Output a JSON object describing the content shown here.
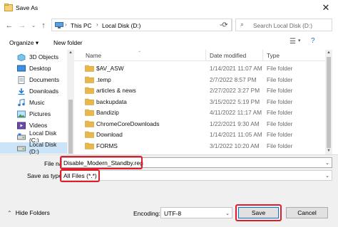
{
  "window": {
    "title": "Save As"
  },
  "address": {
    "crumbs": [
      "This PC",
      "Local Disk (D:)"
    ]
  },
  "search": {
    "placeholder": "Search Local Disk (D:)"
  },
  "toolbar": {
    "organize": "Organize ▾",
    "new_folder": "New folder"
  },
  "sidebar": {
    "items": [
      {
        "label": "3D Objects",
        "icon": "cube-icon"
      },
      {
        "label": "Desktop",
        "icon": "desktop-icon"
      },
      {
        "label": "Documents",
        "icon": "documents-icon"
      },
      {
        "label": "Downloads",
        "icon": "downloads-icon"
      },
      {
        "label": "Music",
        "icon": "music-icon"
      },
      {
        "label": "Pictures",
        "icon": "pictures-icon"
      },
      {
        "label": "Videos",
        "icon": "videos-icon"
      },
      {
        "label": "Local Disk (C:)",
        "icon": "drive-icon"
      },
      {
        "label": "Local Disk (D:)",
        "icon": "drive-icon",
        "selected": true
      }
    ]
  },
  "files": {
    "columns": {
      "name": "Name",
      "date": "Date modified",
      "type": "Type"
    },
    "rows": [
      {
        "name": "$AV_ASW",
        "date": "1/14/2021 11:07 AM",
        "type": "File folder"
      },
      {
        "name": ".temp",
        "date": "2/7/2022 8:57 PM",
        "type": "File folder"
      },
      {
        "name": "articles & news",
        "date": "2/27/2022 3:27 PM",
        "type": "File folder"
      },
      {
        "name": "backupdata",
        "date": "3/15/2022 5:19 PM",
        "type": "File folder"
      },
      {
        "name": "Bandizip",
        "date": "4/11/2022 11:17 AM",
        "type": "File folder"
      },
      {
        "name": "ChromeCoreDownloads",
        "date": "1/22/2021 9:30 AM",
        "type": "File folder"
      },
      {
        "name": "Download",
        "date": "1/14/2021 11:05 AM",
        "type": "File folder"
      },
      {
        "name": "FORMS",
        "date": "3/1/2022 10:20 AM",
        "type": "File folder"
      }
    ]
  },
  "form": {
    "file_name_label": "File name:",
    "file_name_value": "Disable_Modern_Standby.reg",
    "save_as_type_label": "Save as type:",
    "save_as_type_value": "All Files  (*.*)",
    "hide_folders": "Hide Folders",
    "encoding_label": "Encoding:",
    "encoding_value": "UTF-8",
    "save": "Save",
    "cancel": "Cancel"
  },
  "colors": {
    "highlight": "#e01d2b",
    "selection": "#cce4f7",
    "folder": "#e8b84a",
    "accent": "#0078d7"
  }
}
